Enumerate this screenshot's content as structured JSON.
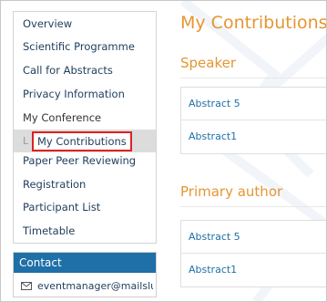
{
  "sidebar": {
    "items": [
      {
        "label": "Overview"
      },
      {
        "label": "Scientific Programme"
      },
      {
        "label": "Call for Abstracts"
      },
      {
        "label": "Privacy Information"
      },
      {
        "label": "My Conference"
      },
      {
        "label": "My Contributions",
        "marker": "L"
      },
      {
        "label": "Paper Peer Reviewing"
      },
      {
        "label": "Registration"
      },
      {
        "label": "Participant List"
      },
      {
        "label": "Timetable"
      }
    ]
  },
  "contact": {
    "header": "Contact",
    "email": "eventmanager@mailslur..."
  },
  "main": {
    "title": "My Contributions",
    "sections": [
      {
        "heading": "Speaker",
        "items": [
          "Abstract 5",
          "Abstract1"
        ]
      },
      {
        "heading": "Primary author",
        "items": [
          "Abstract 5",
          "Abstract1"
        ]
      }
    ]
  },
  "colors": {
    "accent": "#e69533",
    "link": "#1f6fa8",
    "contact_header": "#1f6fa8",
    "highlight_border": "#e02020"
  }
}
